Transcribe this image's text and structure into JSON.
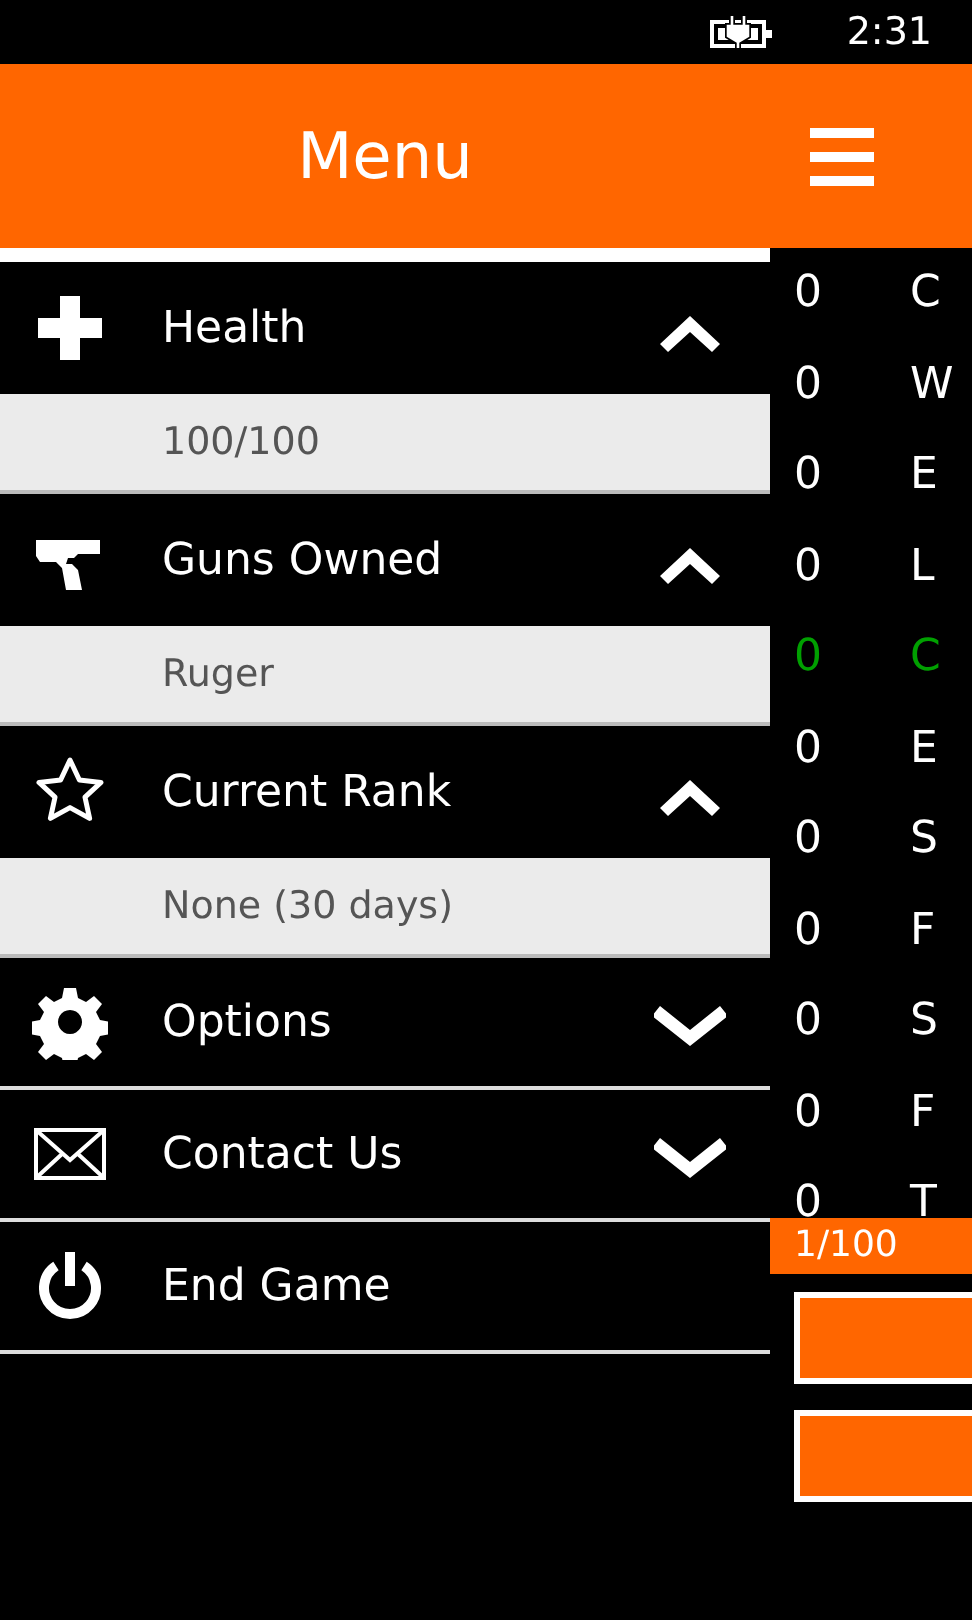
{
  "status_bar": {
    "time": "2:31"
  },
  "header": {
    "title": "Menu"
  },
  "menu": [
    {
      "kind": "section",
      "label": "Health",
      "expanded": true,
      "detail": "100/100"
    },
    {
      "kind": "section",
      "label": "Guns Owned",
      "expanded": true,
      "detail": "Ruger"
    },
    {
      "kind": "section",
      "label": "Current Rank",
      "expanded": true,
      "detail": "None (30 days)"
    },
    {
      "kind": "section",
      "label": "Options",
      "expanded": false
    },
    {
      "kind": "section",
      "label": "Contact Us",
      "expanded": false
    },
    {
      "kind": "action",
      "label": "End Game"
    }
  ],
  "stats": [
    {
      "value": "0",
      "label": "C",
      "color": "#ffffff"
    },
    {
      "value": "0",
      "label": "W",
      "color": "#ffffff"
    },
    {
      "value": "0",
      "label": "E",
      "color": "#ffffff"
    },
    {
      "value": "0",
      "label": "L",
      "color": "#ffffff"
    },
    {
      "value": "0",
      "label": "C",
      "color": "#00a000"
    },
    {
      "value": "0",
      "label": "E",
      "color": "#ffffff"
    },
    {
      "value": "0",
      "label": "S",
      "color": "#ffffff"
    },
    {
      "value": "0",
      "label": "F",
      "color": "#ffffff"
    },
    {
      "value": "0",
      "label": "S",
      "color": "#ffffff"
    },
    {
      "value": "0",
      "label": "F",
      "color": "#ffffff"
    },
    {
      "value": "0",
      "label": "T",
      "color": "#ffffff"
    }
  ],
  "progress": {
    "text": "1/100"
  },
  "buttons": [
    {
      "kind": "blank"
    },
    {
      "kind": "blank"
    }
  ]
}
